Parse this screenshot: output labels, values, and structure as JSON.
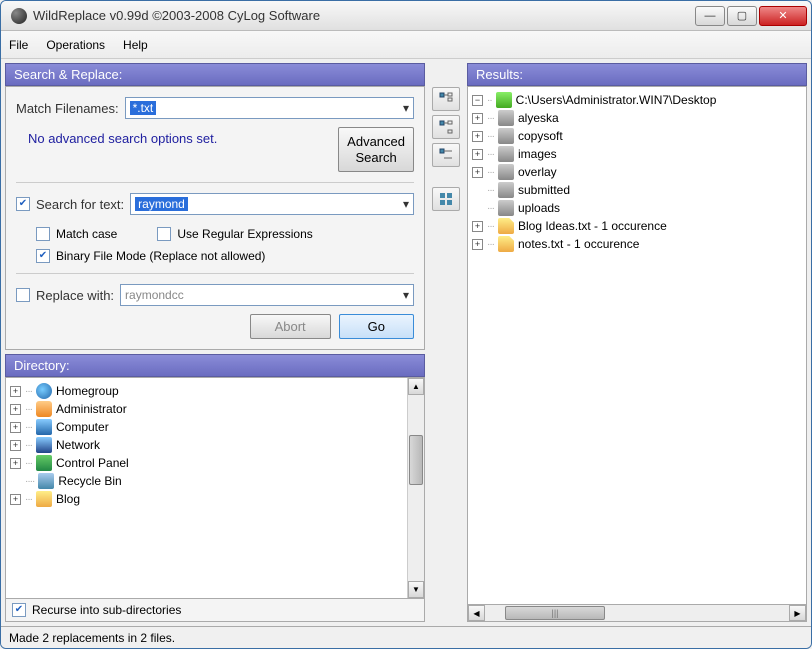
{
  "window": {
    "title": "WildReplace v0.99d ©2003-2008 CyLog Software"
  },
  "menu": {
    "file": "File",
    "operations": "Operations",
    "help": "Help"
  },
  "search": {
    "header": "Search & Replace:",
    "match_filenames_label": "Match Filenames:",
    "match_filenames_value": "*.txt",
    "no_advanced": "No advanced search options set.",
    "advanced_button": "Advanced\nSearch",
    "search_for_text_label": "Search for text:",
    "search_for_text_value": "raymond",
    "match_case": "Match case",
    "use_regex": "Use Regular Expressions",
    "binary_mode": "Binary File Mode (Replace not allowed)",
    "replace_with_label": "Replace with:",
    "replace_with_value": "raymondcc",
    "abort": "Abort",
    "go": "Go"
  },
  "directory": {
    "header": "Directory:",
    "items": [
      "Homegroup",
      "Administrator",
      "Computer",
      "Network",
      "Control Panel",
      "Recycle Bin",
      "Blog"
    ],
    "recurse": "Recurse into sub-directories"
  },
  "results": {
    "header": "Results:",
    "root": "C:\\Users\\Administrator.WIN7\\Desktop",
    "items": [
      {
        "name": "alyeska",
        "type": "folder",
        "expandable": true
      },
      {
        "name": "copysoft",
        "type": "folder",
        "expandable": true
      },
      {
        "name": "images",
        "type": "folder",
        "expandable": true
      },
      {
        "name": "overlay",
        "type": "folder",
        "expandable": true
      },
      {
        "name": "submitted",
        "type": "folder",
        "expandable": false
      },
      {
        "name": "uploads",
        "type": "folder",
        "expandable": false
      },
      {
        "name": "Blog Ideas.txt - 1 occurence",
        "type": "file",
        "expandable": true
      },
      {
        "name": "notes.txt - 1 occurence",
        "type": "file",
        "expandable": true
      }
    ]
  },
  "status": "Made 2 replacements in 2 files."
}
